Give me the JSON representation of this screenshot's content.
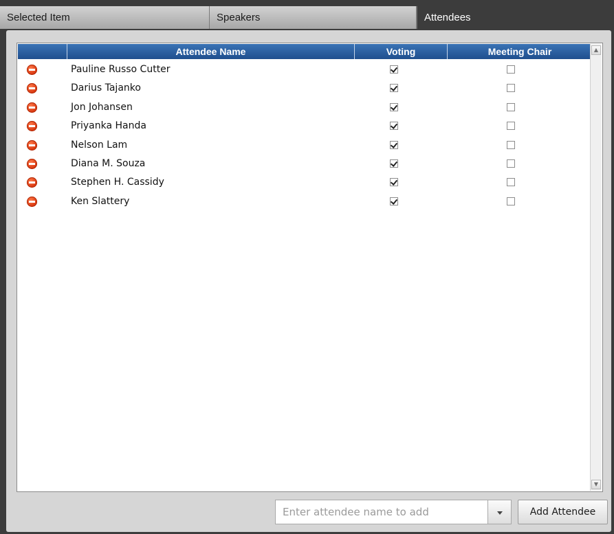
{
  "tabs": [
    {
      "label": "Selected Item"
    },
    {
      "label": "Speakers"
    },
    {
      "label": "Attendees",
      "active": true
    }
  ],
  "grid": {
    "columns": {
      "remove": "",
      "name": "Attendee Name",
      "voting": "Voting",
      "chair": "Meeting Chair"
    },
    "rows": [
      {
        "name": "Pauline Russo Cutter",
        "voting": true,
        "chair": false
      },
      {
        "name": "Darius Tajanko",
        "voting": true,
        "chair": false
      },
      {
        "name": "Jon Johansen",
        "voting": true,
        "chair": false
      },
      {
        "name": "Priyanka Handa",
        "voting": true,
        "chair": false
      },
      {
        "name": "Nelson Lam",
        "voting": true,
        "chair": false
      },
      {
        "name": "Diana M. Souza",
        "voting": true,
        "chair": false
      },
      {
        "name": "Stephen H. Cassidy",
        "voting": true,
        "chair": false
      },
      {
        "name": "Ken Slattery",
        "voting": true,
        "chair": false
      }
    ]
  },
  "footer": {
    "input_placeholder": "Enter attendee name to add",
    "add_label": "Add Attendee"
  },
  "icons": {
    "remove": "remove-circle-icon",
    "dropdown": "chevron-down-icon",
    "scroll_up": "scroll-up-arrow-icon",
    "scroll_down": "scroll-down-arrow-icon"
  },
  "colors": {
    "header_bg": "#2a5fa3",
    "tab_active_bg": "#3c3c3c",
    "remove_icon": "#e0400f",
    "panel_bg": "#d6d6d6"
  }
}
